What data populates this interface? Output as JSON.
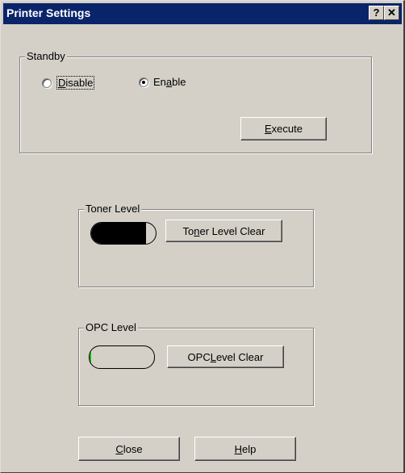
{
  "window": {
    "title": "Printer Settings",
    "help_glyph": "?",
    "close_glyph": "✕"
  },
  "standby": {
    "group_label": "Standby",
    "options": [
      {
        "label_prefix": "",
        "label_key": "D",
        "label_rest": "isable",
        "selected": false
      },
      {
        "label_prefix": "En",
        "label_key": "a",
        "label_rest": "ble",
        "selected": true
      }
    ],
    "execute_prefix": "",
    "execute_key": "E",
    "execute_rest": "xecute"
  },
  "toner": {
    "group_label": "Toner Level",
    "level_fraction": 0.85,
    "fill_color": "#000000",
    "clear_prefix": "To",
    "clear_key": "n",
    "clear_rest": "er Level Clear"
  },
  "opc": {
    "group_label": "OPC Level",
    "level_fraction": 0.02,
    "fill_color": "#00c000",
    "clear_prefix": "OPC ",
    "clear_key": "L",
    "clear_rest": "evel Clear"
  },
  "footer": {
    "close_prefix": "",
    "close_key": "C",
    "close_rest": "lose",
    "help_prefix": "",
    "help_key": "H",
    "help_rest": "elp"
  }
}
